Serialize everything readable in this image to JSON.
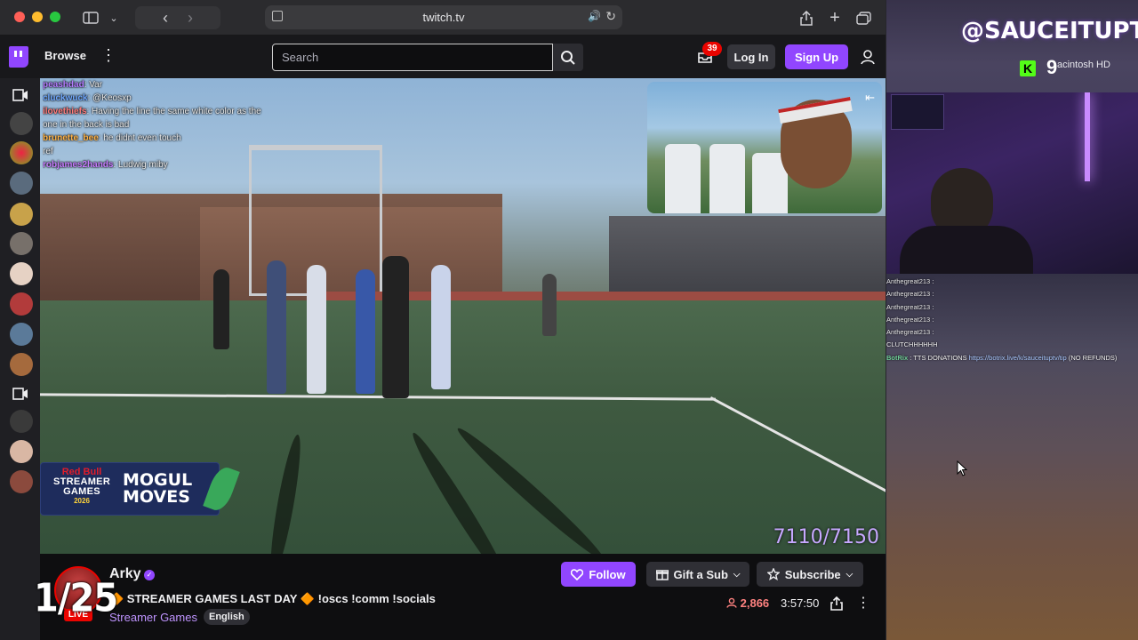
{
  "browser": {
    "url": "twitch.tv"
  },
  "nav": {
    "browse_label": "Browse",
    "search_placeholder": "Search",
    "notifications_count": "39",
    "login_label": "Log In",
    "signup_label": "Sign Up"
  },
  "chat_overlay": [
    {
      "user": "peashdad",
      "message": "Var"
    },
    {
      "user": "cluckwuck",
      "message": "@Keosxp"
    },
    {
      "user": "ilovethiefs",
      "message": "Having the line the same white color as the one in the back is bad"
    },
    {
      "user": "brunette_bee",
      "message": "he didnt even touch"
    },
    {
      "user": "",
      "message": "ref"
    },
    {
      "user": "robjames2hands",
      "message": "Ludwig miby"
    }
  ],
  "video_overlay": {
    "redbull_label": "Red Bull",
    "event_name": "STREAMER GAMES",
    "event_year": "2026",
    "segment_line1": "MOGUL",
    "segment_line2": "MOVES",
    "counter": "7110/7150"
  },
  "stream": {
    "channel_name": "Arky",
    "live_label": "LIVE",
    "title": "🔶 STREAMER GAMES LAST DAY 🔶 !oscs !comm !socials",
    "category": "Streamer Games",
    "language": "English",
    "follow_label": "Follow",
    "gift_label": "Gift a Sub",
    "subscribe_label": "Subscribe",
    "viewers": "2,866",
    "uptime": "3:57:50"
  },
  "overlay_counter": "1/25",
  "right_stream": {
    "handle": "@SAUCEITUPTV",
    "kick_number": "9",
    "desktop_label": "acintosh HD",
    "chat": [
      {
        "user": "Anthegreat213",
        "message": ":"
      },
      {
        "user": "Anthegreat213",
        "message": ":"
      },
      {
        "user": "Anthegreat213",
        "message": ":"
      },
      {
        "user": "Anthegreat213",
        "message": ":"
      },
      {
        "user": "Anthegreat213",
        "message": ":"
      },
      {
        "user": "",
        "message": "CLUTCHHHHHH"
      },
      {
        "user": "BotRix",
        "message": "TTS DONATIONS",
        "link": "https://botrix.live/k/sauceituptv/tip",
        "suffix": "(NO REFUNDS)"
      }
    ]
  },
  "colors": {
    "twitch_purple": "#9146ff",
    "live_red": "#eb0400",
    "category_purple": "#bf94ff"
  }
}
